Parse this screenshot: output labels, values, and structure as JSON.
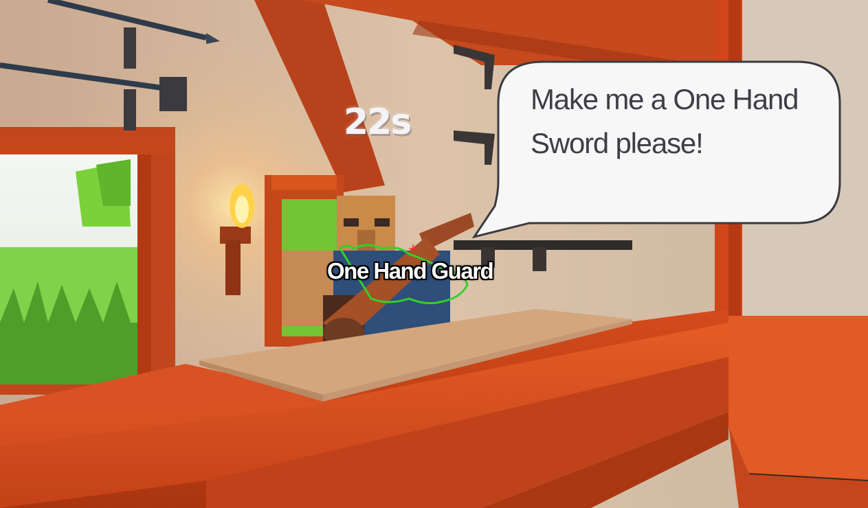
{
  "hud": {
    "timer": "22s",
    "target_label": "One Hand Guard",
    "crosshair_icon": "crosshair-icon"
  },
  "customer": {
    "request": "Make me a One Hand\nSword please!"
  },
  "colors": {
    "counter": "#e2531f",
    "wall": "#d9b99a",
    "bubble_fill": "#f7f7f8",
    "bubble_outline": "#3a3a40",
    "highlight_outline": "#33d12a"
  }
}
